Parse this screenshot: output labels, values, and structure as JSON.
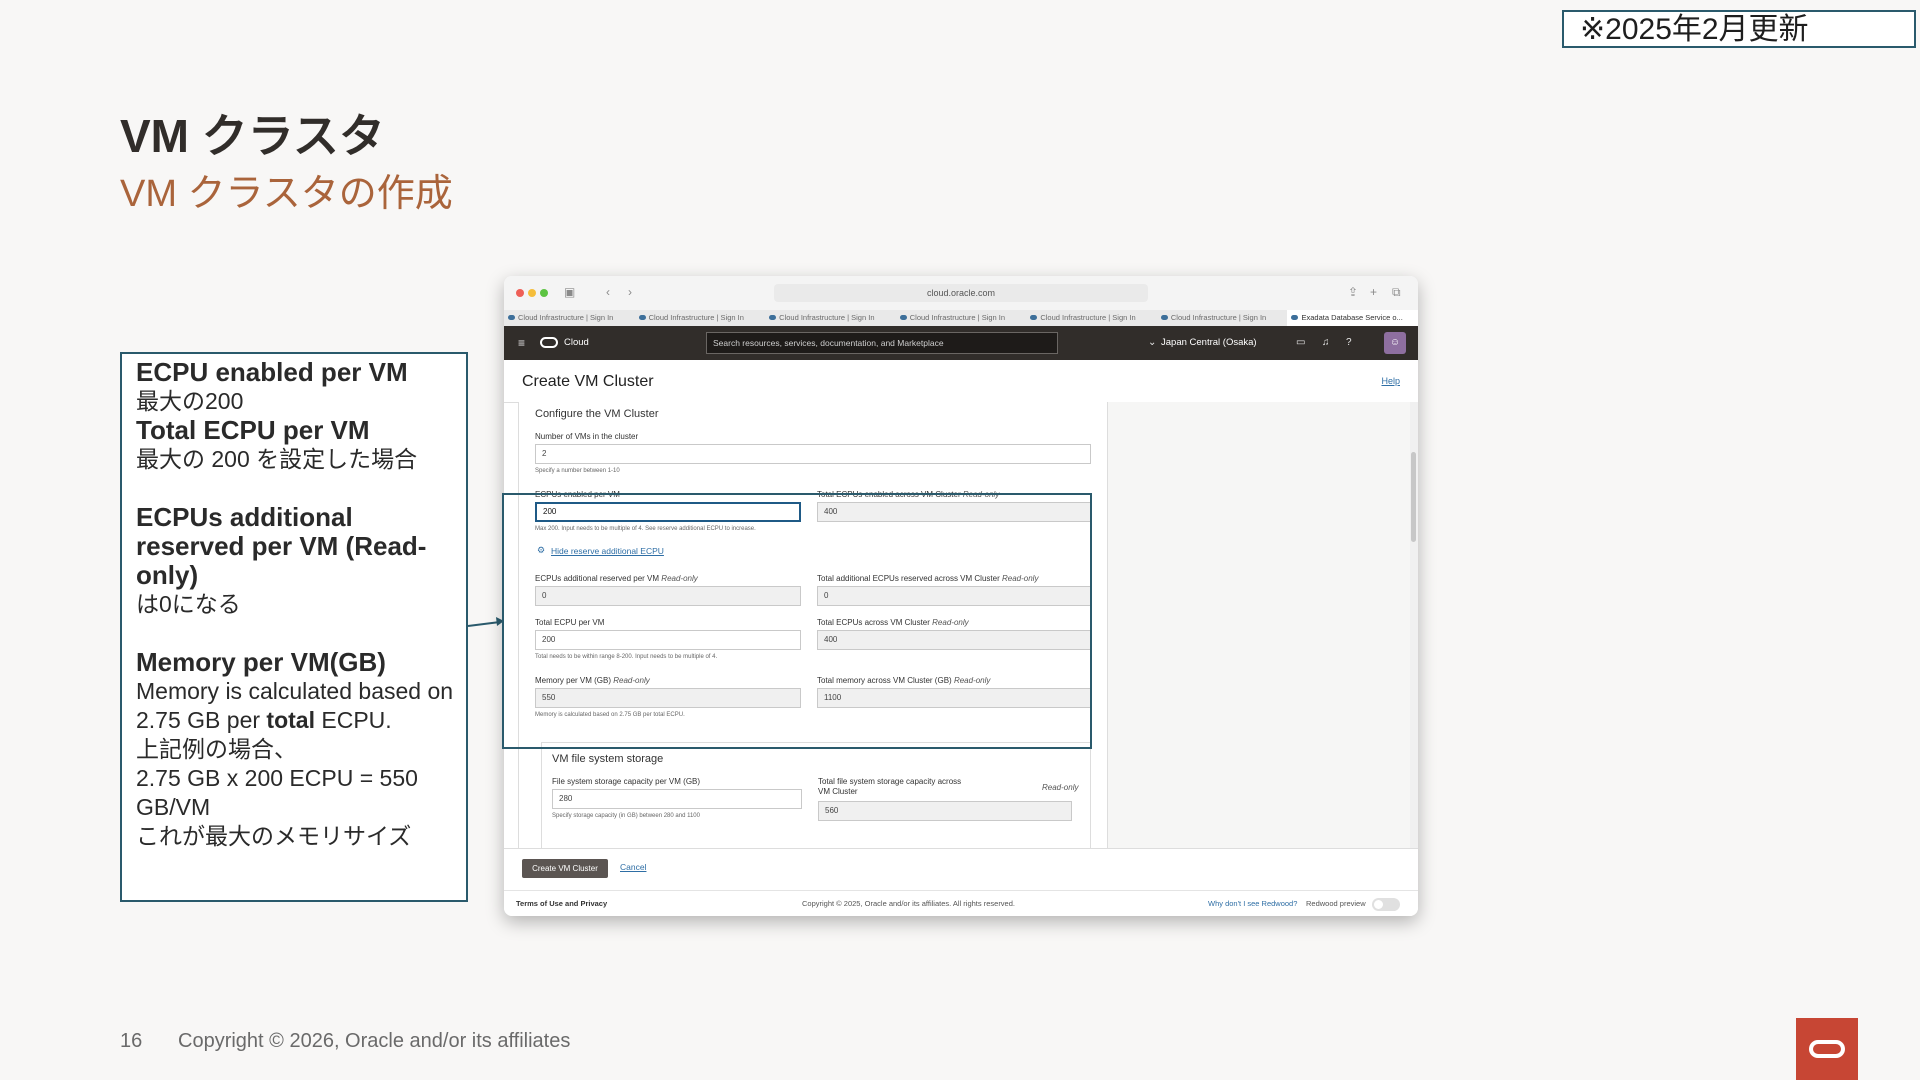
{
  "update_note": "※2025年2月更新",
  "slide": {
    "title": "VM クラスタ",
    "subtitle": "VM クラスタの作成",
    "page_number": "16",
    "copyright": "Copyright © 2026, Oracle and/or its affiliates"
  },
  "callout": {
    "h1": "ECPU enabled per VM",
    "t1": "最大の200",
    "h2": "Total ECPU per VM",
    "t2": "最大の 200 を設定した場合",
    "h3": "ECPUs additional reserved per VM (Read-only)",
    "t3": "は0になる",
    "h4": "Memory per VM(GB)",
    "t4a": "Memory is calculated based on 2.75 GB per ",
    "t4b": "total",
    "t4c": " ECPU.",
    "t5": "上記例の場合、",
    "t6": "2.75 GB x 200 ECPU = 550 GB/VM",
    "t7": "これが最大のメモリサイズ"
  },
  "browser": {
    "url": "cloud.oracle.com",
    "tabs": [
      "Cloud Infrastructure | Sign In",
      "Cloud Infrastructure | Sign In",
      "Cloud Infrastructure | Sign In",
      "Cloud Infrastructure | Sign In",
      "Cloud Infrastructure | Sign In",
      "Cloud Infrastructure | Sign In",
      "Exadata Database Service o..."
    ]
  },
  "console": {
    "brand": "Cloud",
    "search_placeholder": "Search resources, services, documentation, and Marketplace",
    "region": "Japan Central (Osaka)",
    "page_title": "Create VM Cluster",
    "help": "Help"
  },
  "form": {
    "section_title": "Configure the VM Cluster",
    "num_vms_label": "Number of VMs in the cluster",
    "num_vms_value": "2",
    "num_vms_hint": "Specify a number between 1-10",
    "ecpu_per_vm_label": "ECPUs enabled per VM",
    "ecpu_per_vm_value": "200",
    "ecpu_per_vm_hint": "Max 200. Input needs to be multiple of 4. See reserve additional ECPU to increase.",
    "total_ecpu_cluster_label": "Total ECPUs enabled across VM Cluster",
    "read_only": "Read-only",
    "total_ecpu_cluster_value": "400",
    "hide_link": "Hide reserve additional ECPU",
    "add_reserved_label": "ECPUs additional reserved per VM",
    "add_reserved_value": "0",
    "total_add_reserved_label": "Total additional ECPUs reserved across VM Cluster",
    "total_add_reserved_value": "0",
    "total_ecpu_vm_label": "Total ECPU per VM",
    "total_ecpu_vm_value": "200",
    "total_ecpu_vm_hint": "Total needs to be within range 8-200. Input needs to be multiple of 4.",
    "total_ecpus_across_label": "Total ECPUs across VM Cluster",
    "total_ecpus_across_value": "400",
    "memory_label": "Memory per VM (GB)",
    "memory_value": "550",
    "memory_hint": "Memory is calculated based on 2.75 GB per total ECPU.",
    "total_memory_label": "Total memory across VM Cluster (GB)",
    "total_memory_value": "1100",
    "fs_section_title": "VM file system storage",
    "fs_label": "File system storage capacity per VM (GB)",
    "fs_value": "280",
    "fs_hint": "Specify storage capacity (in GB) between 280 and 1100",
    "fs_total_label": "Total file system storage capacity across VM Cluster",
    "fs_total_value": "560"
  },
  "actions": {
    "create": "Create VM Cluster",
    "cancel": "Cancel"
  },
  "bottom": {
    "terms": "Terms of Use and Privacy",
    "copyright": "Copyright © 2025, Oracle and/or its affiliates. All rights reserved.",
    "redwood_link": "Why don't I see Redwood?",
    "redwood_label": "Redwood preview"
  }
}
